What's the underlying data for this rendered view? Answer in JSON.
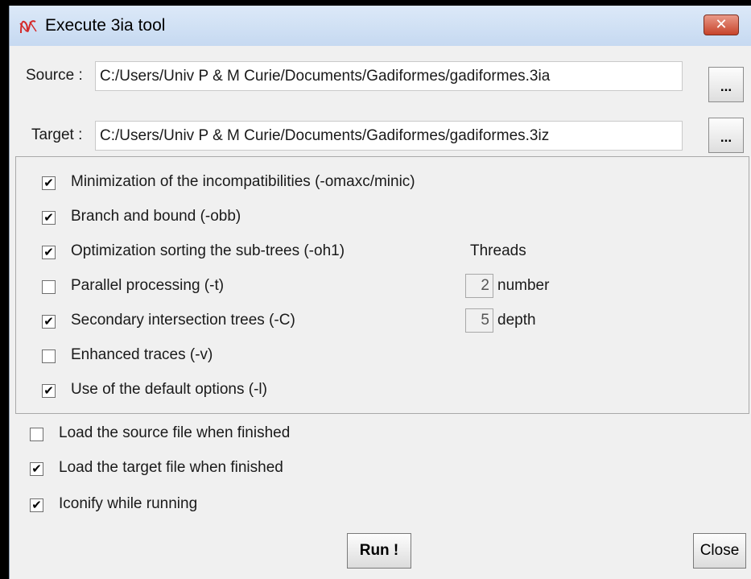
{
  "window": {
    "title": "Execute 3ia tool",
    "close_glyph": "✕",
    "icon": "app-icon"
  },
  "source": {
    "label": "Source :",
    "value": "C:/Users/Univ P & M Curie/Documents/Gadiformes/gadiformes.3ia",
    "browse_label": "..."
  },
  "target": {
    "label": "Target :",
    "value": "C:/Users/Univ P & M Curie/Documents/Gadiformes/gadiformes.3iz",
    "browse_label": "..."
  },
  "options": [
    {
      "label": "Minimization of the incompatibilities (-omaxc/minic)",
      "checked": true
    },
    {
      "label": "Branch and bound (-obb)",
      "checked": true
    },
    {
      "label": "Optimization sorting the sub-trees (-oh1)",
      "checked": true
    },
    {
      "label": "Parallel processing (-t)",
      "checked": false
    },
    {
      "label": "Secondary intersection trees (-C)",
      "checked": true
    },
    {
      "label": "Enhanced traces (-v)",
      "checked": false
    },
    {
      "label": "Use of the default options (-l)",
      "checked": true
    }
  ],
  "threads": {
    "header": "Threads",
    "number_value": "2",
    "number_label": "number",
    "depth_value": "5",
    "depth_label": "depth"
  },
  "post_options": [
    {
      "label": "Load the source file when finished",
      "checked": false
    },
    {
      "label": "Load the target file when finished",
      "checked": true
    },
    {
      "label": "Iconify while running",
      "checked": true
    }
  ],
  "buttons": {
    "run": "Run !",
    "close": "Close"
  },
  "colors": {
    "accent_icon": "#d42a2a",
    "close_button": "#c7432a",
    "titlebar": "#c6d9f1"
  }
}
